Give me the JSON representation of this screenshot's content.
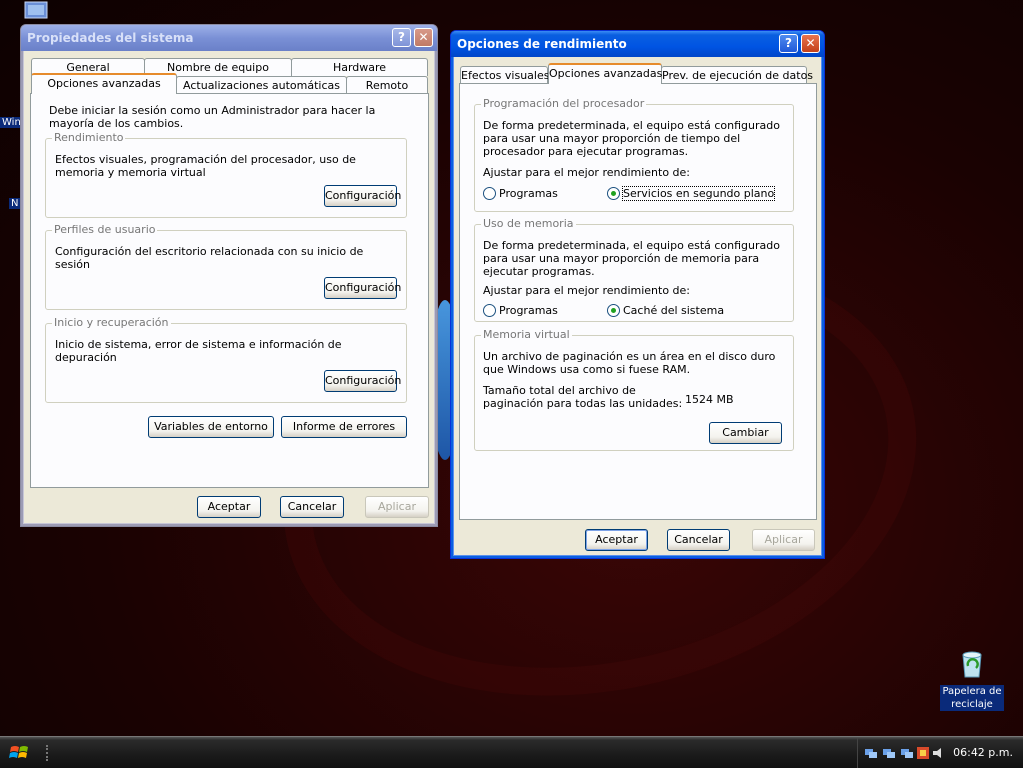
{
  "desktop": {
    "partial_label_1": "Win",
    "partial_label_2": "N",
    "recycle_bin": "Papelera de reciclaje"
  },
  "sysprops": {
    "title": "Propiedades del sistema",
    "help_glyph": "?",
    "close_glyph": "✕",
    "tabs_row1": [
      "General",
      "Nombre de equipo",
      "Hardware"
    ],
    "tabs_row2": [
      "Opciones avanzadas",
      "Actualizaciones automáticas",
      "Remoto"
    ],
    "intro": "Debe iniciar la sesión como un Administrador para hacer la mayoría de los cambios.",
    "performance": {
      "label": "Rendimiento",
      "text": "Efectos visuales, programación del procesador, uso de memoria y memoria virtual",
      "button": "Configuración"
    },
    "profiles": {
      "label": "Perfiles de usuario",
      "text": "Configuración del escritorio relacionada con su inicio de sesión",
      "button": "Configuración"
    },
    "startup": {
      "label": "Inicio y recuperación",
      "text": "Inicio de sistema, error de sistema e información de depuración",
      "button": "Configuración"
    },
    "env_vars_button": "Variables de entorno",
    "error_report_button": "Informe de errores",
    "ok": "Aceptar",
    "cancel": "Cancelar",
    "apply": "Aplicar"
  },
  "perf": {
    "title": "Opciones de rendimiento",
    "help_glyph": "?",
    "close_glyph": "✕",
    "tabs": [
      "Efectos visuales",
      "Opciones avanzadas",
      "Prev. de ejecución de datos"
    ],
    "processor": {
      "label": "Programación del procesador",
      "text": "De forma predeterminada, el equipo está configurado para usar una mayor proporción de tiempo del procesador para ejecutar programas.",
      "adjust": "Ajustar para el mejor rendimiento de:",
      "option1": "Programas",
      "option2": "Servicios en segundo plano"
    },
    "memory": {
      "label": "Uso de memoria",
      "text": "De forma predeterminada, el equipo está configurado para usar una mayor proporción de memoria para ejecutar programas.",
      "adjust": "Ajustar para el mejor rendimiento de:",
      "option1": "Programas",
      "option2": "Caché del sistema"
    },
    "virtual": {
      "label": "Memoria virtual",
      "text": "Un archivo de paginación es un área en el disco duro que Windows usa como si fuese RAM.",
      "total_label": "Tamaño total del archivo de paginación para todas las unidades:",
      "total_value": "1524 MB",
      "change_button": "Cambiar"
    },
    "ok": "Aceptar",
    "cancel": "Cancelar",
    "apply": "Aplicar"
  },
  "taskbar": {
    "clock": "06:42 p.m."
  },
  "colors": {
    "title_active": "#0054e3",
    "title_inactive": "#7a90d6",
    "dialog_bg": "#ece9d8",
    "tab_highlight": "#e68b2c",
    "radio_green": "#21a121"
  }
}
